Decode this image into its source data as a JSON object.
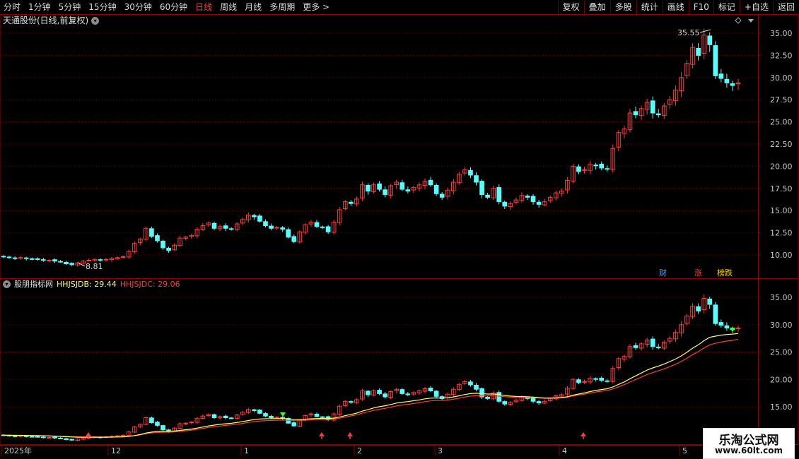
{
  "toolbar": {
    "periods": [
      "分时",
      "1分钟",
      "5分钟",
      "15分钟",
      "30分钟",
      "60分钟",
      "日线",
      "周线",
      "月线",
      "多周期",
      "更多 >"
    ],
    "active_period": "日线",
    "buttons": [
      "复权",
      "叠加",
      "多股",
      "统计",
      "画线",
      "F10",
      "标记",
      "+自选",
      "返回"
    ]
  },
  "main_pane": {
    "title": "天通股份(日线,前复权)",
    "y_ticks": [
      "35.00",
      "32.50",
      "30.00",
      "27.50",
      "25.00",
      "22.50",
      "20.00",
      "17.50",
      "15.00",
      "12.50",
      "10.00"
    ],
    "high_label": "35.55",
    "low_label": "8.81",
    "badges": [
      {
        "text": "财",
        "color": "#4aa3ff"
      },
      {
        "text": "涨",
        "color": "#ff4040"
      },
      {
        "text": "榜跌",
        "color": "#ffd700"
      }
    ]
  },
  "indicator_pane": {
    "title": "股朋指标网",
    "series": [
      {
        "label": "HHJSJDB: 29.44",
        "color": "#ffff66"
      },
      {
        "label": "HHJSJDC: 29.06",
        "color": "#ff3b3b"
      }
    ],
    "y_ticks": [
      "35.00",
      "30.00",
      "25.00",
      "20.00",
      "15.00"
    ]
  },
  "time_axis": {
    "labels": [
      "2025年",
      "12",
      "1",
      "2",
      "3",
      "4",
      "5"
    ]
  },
  "watermark": {
    "title": "乐淘公式网",
    "url": "www.60lt.com"
  },
  "colors": {
    "up": "#ff3b3b",
    "down": "#54ffff",
    "grid": "#7a0000",
    "line_b": "#ffff66",
    "line_c": "#ff3b3b"
  },
  "chart_data": {
    "type": "candlestick",
    "ylim": [
      8,
      36
    ],
    "closes": [
      9.8,
      9.7,
      9.6,
      9.7,
      9.6,
      9.5,
      9.5,
      9.4,
      9.4,
      9.3,
      9.2,
      9.0,
      8.9,
      9.1,
      9.3,
      9.4,
      9.5,
      9.4,
      9.5,
      9.6,
      9.7,
      9.8,
      10.4,
      11.3,
      11.8,
      13.0,
      12.1,
      11.6,
      10.8,
      10.5,
      11.1,
      11.9,
      12.0,
      12.2,
      12.9,
      13.3,
      13.6,
      13.0,
      13.2,
      13.0,
      12.9,
      13.5,
      14.0,
      14.5,
      14.3,
      13.8,
      13.3,
      13.0,
      13.1,
      12.9,
      12.0,
      11.5,
      12.6,
      13.4,
      13.7,
      13.2,
      13.1,
      12.6,
      13.7,
      15.1,
      16.0,
      15.8,
      16.3,
      17.9,
      17.2,
      17.9,
      17.4,
      16.8,
      17.8,
      18.2,
      17.4,
      17.2,
      17.6,
      17.9,
      18.3,
      17.9,
      16.9,
      16.5,
      17.3,
      18.2,
      19.1,
      19.6,
      19.0,
      18.2,
      16.8,
      16.5,
      17.5,
      16.0,
      15.5,
      15.8,
      16.2,
      16.7,
      16.5,
      16.0,
      15.7,
      16.0,
      16.5,
      17.0,
      17.2,
      18.4,
      20.0,
      19.4,
      19.6,
      20.2,
      20.1,
      19.8,
      19.7,
      22.0,
      23.8,
      24.2,
      26.0,
      25.8,
      26.5,
      27.2,
      26.0,
      25.8,
      26.8,
      27.5,
      28.6,
      30.0,
      31.6,
      33.4,
      32.5,
      34.8,
      33.7,
      30.2,
      29.9,
      29.4,
      29.1,
      29.4
    ],
    "series_b_last": 29.44,
    "series_c_last": 29.06
  }
}
